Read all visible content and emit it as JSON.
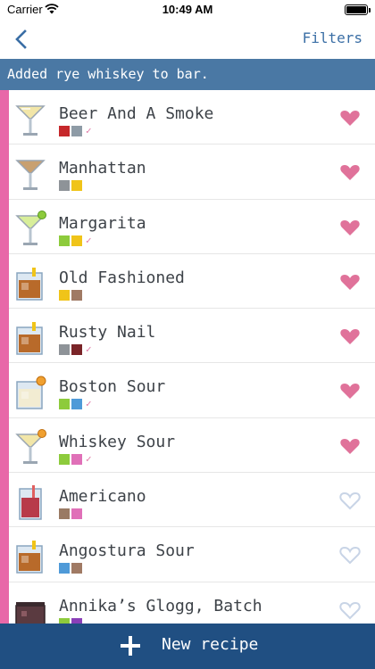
{
  "status_bar": {
    "carrier": "Carrier",
    "time": "10:49 AM"
  },
  "nav": {
    "filters_label": "Filters"
  },
  "banner": {
    "message": "Added rye whiskey to bar."
  },
  "colors": {
    "accent": "#3a6ea5",
    "banner": "#4a78a4",
    "stripe": "#e868a8",
    "bottom_bar": "#204f82",
    "heart_filled": "#e0729a",
    "heart_outline": "#c8d4e6"
  },
  "recipes": [
    {
      "name": "Beer And A Smoke",
      "glass": "martini-yellow",
      "swatches": [
        "#c6282b",
        "#8e9ba6"
      ],
      "check": "✓",
      "favorite": true
    },
    {
      "name": "Manhattan",
      "glass": "martini-brown",
      "swatches": [
        "#8e9398",
        "#f0c419"
      ],
      "check": "",
      "favorite": true
    },
    {
      "name": "Margarita",
      "glass": "margarita-lime",
      "swatches": [
        "#8dcb3c",
        "#f0c419"
      ],
      "check": "✓",
      "favorite": true
    },
    {
      "name": "Old Fashioned",
      "glass": "rocks-amber",
      "swatches": [
        "#f0c419",
        "#a07a64"
      ],
      "check": "",
      "favorite": true
    },
    {
      "name": "Rusty Nail",
      "glass": "rocks-amber",
      "swatches": [
        "#8e9398",
        "#7a2428"
      ],
      "check": "✓",
      "favorite": true
    },
    {
      "name": "Boston Sour",
      "glass": "rocks-cream",
      "swatches": [
        "#8dcb3c",
        "#4f9ad8"
      ],
      "check": "✓",
      "favorite": true
    },
    {
      "name": "Whiskey Sour",
      "glass": "martini-orange",
      "swatches": [
        "#8dcb3c",
        "#e070b8"
      ],
      "check": "✓",
      "favorite": true
    },
    {
      "name": "Americano",
      "glass": "highball-red",
      "swatches": [
        "#9a7a64",
        "#e070b8"
      ],
      "check": "",
      "favorite": false
    },
    {
      "name": "Angostura Sour",
      "glass": "rocks-amber",
      "swatches": [
        "#4f9ad8",
        "#a07a64"
      ],
      "check": "",
      "favorite": false
    },
    {
      "name": "Annika’s Glogg, Batch",
      "glass": "pot-dark",
      "swatches": [
        "#8dcb3c",
        "#8a3fb8"
      ],
      "check": "",
      "favorite": false
    }
  ],
  "bottom": {
    "new_recipe_label": "New recipe"
  }
}
